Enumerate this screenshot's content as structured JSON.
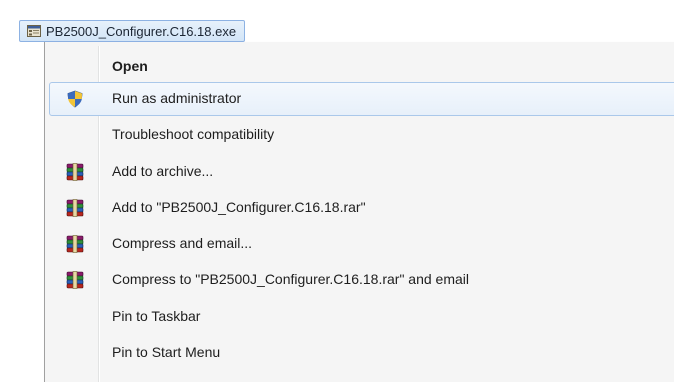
{
  "file": {
    "name": "PB2500J_Configurer.C16.18.exe",
    "icon": "exe-file-icon"
  },
  "menu": {
    "items": [
      {
        "label": "Open",
        "icon": null,
        "bold": true
      },
      {
        "label": "Run as administrator",
        "icon": "uac-shield-icon",
        "highlighted": true
      },
      {
        "label": "Troubleshoot compatibility",
        "icon": null
      },
      {
        "label": "Add to archive...",
        "icon": "winrar-books-icon"
      },
      {
        "label": "Add to \"PB2500J_Configurer.C16.18.rar\"",
        "icon": "winrar-books-icon"
      },
      {
        "label": "Compress and email...",
        "icon": "winrar-books-icon"
      },
      {
        "label": "Compress to \"PB2500J_Configurer.C16.18.rar\" and email",
        "icon": "winrar-books-icon"
      },
      {
        "label": "Pin to Taskbar",
        "icon": null
      },
      {
        "label": "Pin to Start Menu",
        "icon": null
      }
    ]
  },
  "colors": {
    "menu_background": "#f5f5f5",
    "highlight_border": "#aac8ea",
    "file_label_border": "#8db2e3"
  }
}
